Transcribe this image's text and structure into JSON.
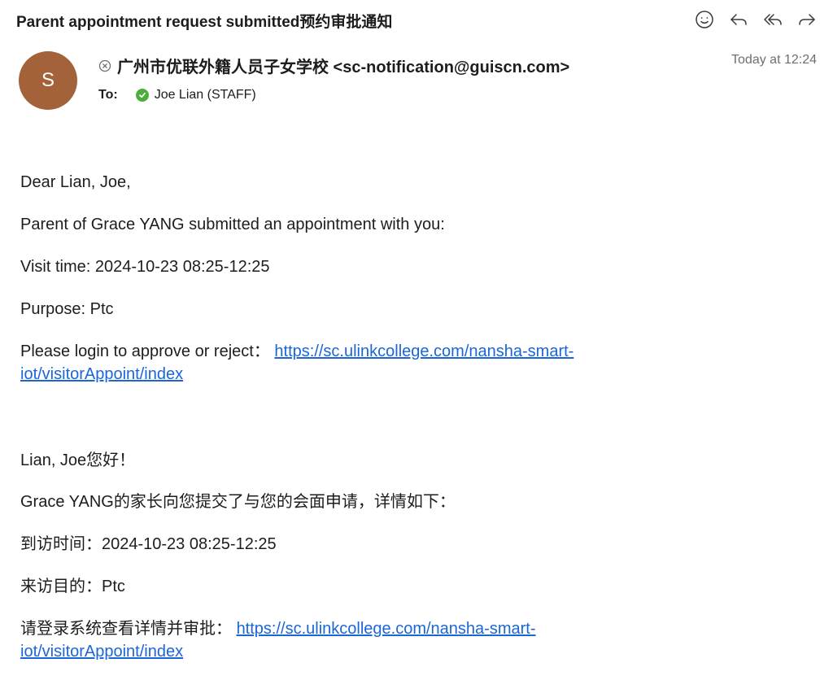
{
  "email": {
    "subject": "Parent appointment request submitted预约审批通知",
    "sender": {
      "avatar_initial": "S",
      "display": "广州市优联外籍人员子女学校 <sc-notification@guiscn.com>"
    },
    "timestamp": "Today at 12:24",
    "to_label": "To:",
    "recipient": "Joe Lian (STAFF)"
  },
  "toolbar": {
    "icons": [
      "emoji-icon",
      "reply-icon",
      "reply-all-icon",
      "forward-icon"
    ]
  },
  "body_en": {
    "greeting": "Dear Lian, Joe,",
    "intro": "Parent of Grace YANG submitted an appointment with you:",
    "visit_time": "Visit time: 2024-10-23 08:25-12:25",
    "purpose": "Purpose: Ptc",
    "login_text": "Please login to approve or reject：",
    "link": "https://sc.ulinkcollege.com/nansha-smart-iot/visitorAppoint/index"
  },
  "body_zh": {
    "greeting": "Lian, Joe您好！",
    "intro": "Grace YANG的家长向您提交了与您的会面申请，详情如下：",
    "visit_time": "到访时间：2024-10-23 08:25-12:25",
    "purpose": "来访目的：Ptc",
    "login_text": "请登录系统查看详情并审批：",
    "link": "https://sc.ulinkcollege.com/nansha-smart-iot/visitorAppoint/index"
  },
  "colors": {
    "avatar": "#a3623a",
    "link": "#1a66d9",
    "verified": "#4cae3a"
  }
}
